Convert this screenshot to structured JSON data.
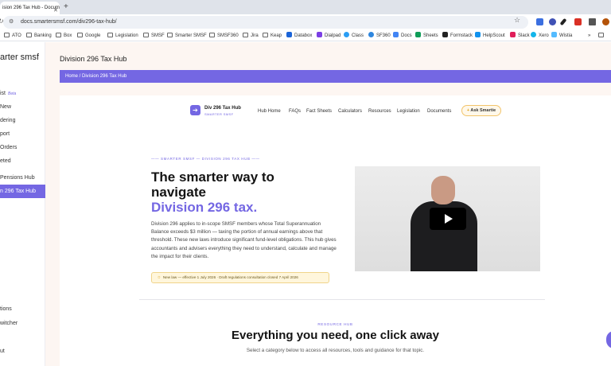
{
  "browser": {
    "tab_title": "ision 296 Tax Hub - Docum",
    "url": "docs.smartersmsf.com/div296-tax-hub/",
    "bookmarks": [
      "ATO",
      "Banking",
      "Box",
      "Google",
      "Legislation",
      "SMSF",
      "Smarter SMSF",
      "SMSF360",
      "Jira",
      "Keap",
      "Databox",
      "Dialpad",
      "Class",
      "SF360",
      "Docs",
      "Sheets",
      "Formstack",
      "HelpScout",
      "Slack",
      "Xero",
      "Wistia"
    ]
  },
  "sidebar": {
    "brand": "arter smsf",
    "beta": "Beta",
    "items": [
      "ist",
      "New",
      "dering",
      "port",
      "Orders",
      "eted",
      "Pensions Hub",
      "n 296 Tax Hub",
      "tions",
      "witcher",
      "ut"
    ]
  },
  "main": {
    "page_title": "Division 296 Tax Hub",
    "breadcrumb": "Home / Division 296 Tax Hub"
  },
  "site": {
    "logo_title": "Div 296 Tax Hub",
    "logo_sub": "SMARTER SMSF",
    "nav": [
      "Hub Home",
      "FAQs",
      "Fact Sheets",
      "Calculators",
      "Resources",
      "Legislation",
      "Documents"
    ],
    "ask": "Ask Smartie",
    "eyebrow": "——  SMARTER SMSF — DIVISION 296 TAX HUB  ——",
    "headline_1": "The smarter way to",
    "headline_2": "navigate",
    "headline_3": "Division 296 tax.",
    "paragraph": "Division 296 applies to in-scope SMSF members whose Total Superannuation Balance exceeds $3 million — taxing the portion of annual earnings above that threshold. These new laws introduce significant fund-level obligations. This hub gives accountants and advisers everything they need to understand, calculate and manage the impact for their clients.",
    "notice": "New law — effective 1 July 2026 · Draft regulations consultation closed 7 April 2026",
    "resource_eyebrow": "RESOURCE HUB",
    "resource_title": "Everything you need, one click away",
    "resource_sub": "Select a category below to access all resources, tools and guidance for that topic."
  },
  "colors": {
    "accent": "#7467e3",
    "notice_bg": "#fff6dc"
  }
}
